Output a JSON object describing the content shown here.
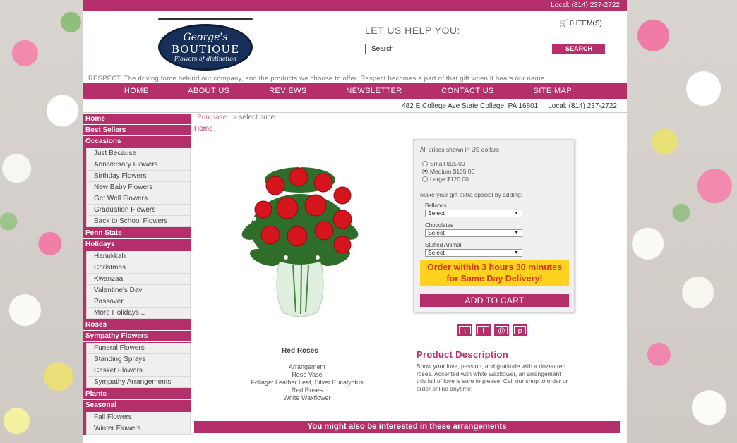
{
  "topbar": {
    "phone": "Local: (814) 237-2722"
  },
  "logo": {
    "line1": "George's",
    "line2": "BOUTIQUE",
    "line3": "Flowers of distinction"
  },
  "header": {
    "help_text": "LET US HELP YOU:",
    "cart_label": "0 ITEM(S)",
    "search_placeholder": "Search",
    "search_button": "SEARCH",
    "tagline": "RESPECT. The driving force behind our company, and the products we choose to offer. Respect becomes a part of that gift when it bears our name."
  },
  "nav": [
    "HOME",
    "ABOUT US",
    "REVIEWS",
    "NEWSLETTER",
    "CONTACT US",
    "SITE MAP"
  ],
  "address_bar": {
    "address": "482 E College Ave State College, PA 16801",
    "phone": "Local: (814) 237-2722"
  },
  "sidebar": [
    {
      "head": "Home",
      "items": []
    },
    {
      "head": "Best Sellers",
      "items": []
    },
    {
      "head": "Occasions",
      "items": [
        "Just Because",
        "Anniversary Flowers",
        "Birthday Flowers",
        "New Baby Flowers",
        "Get Well Flowers",
        "Graduation Flowers",
        "Back to School Flowers"
      ]
    },
    {
      "head": "Penn State",
      "items": []
    },
    {
      "head": "Holidays",
      "items": [
        "Hanukkah",
        "Christmas",
        "Kwanzaa",
        "Valentine's Day",
        "Passover",
        "More Holidays..."
      ]
    },
    {
      "head": "Roses",
      "items": []
    },
    {
      "head": "Sympathy Flowers",
      "items": [
        "Funeral Flowers",
        "Standing Sprays",
        "Casket Flowers",
        "Sympathy Arrangements"
      ]
    },
    {
      "head": "Plants",
      "items": []
    },
    {
      "head": "Seasonal",
      "items": [
        "Fall Flowers",
        "Winter Flowers"
      ]
    }
  ],
  "breadcrumb": {
    "purchase": "Purchase",
    "current": "> select price",
    "home": "Home"
  },
  "product": {
    "name": "Red Roses",
    "details": [
      "Arrangement",
      "Rose Vase",
      "Foliage: Leather Leaf, Silver Eucalyptus",
      "Red Roses",
      "White Waxflower"
    ]
  },
  "pricebox": {
    "note": "All prices shown in US dollars",
    "options": [
      {
        "label": "Small $95.00",
        "selected": false
      },
      {
        "label": "Medium $105.00",
        "selected": true
      },
      {
        "label": "Large $120.00",
        "selected": false
      }
    ],
    "extra_text": "Make your gift extra special by adding:",
    "addons": [
      {
        "label": "Balloons",
        "value": "Select"
      },
      {
        "label": "Chocolates",
        "value": "Select"
      },
      {
        "label": "Stuffed Animal",
        "value": "Select"
      }
    ],
    "delivery_line1": "Order within 3 hours 30 minutes",
    "delivery_line2": "for Same Day Delivery!",
    "add_to_cart": "ADD TO CART"
  },
  "social": [
    "twitter-icon",
    "facebook-icon",
    "email-icon",
    "pinterest-icon"
  ],
  "description": {
    "title": "Product Description",
    "text": "Show your love, passion, and gratitude with a dozen red roses. Accented with white waxflower, an arrangement this full of love is sure to please! Call our shop to order or order online anytime!"
  },
  "also_banner": "You might also be interested in these arrangements",
  "colors": {
    "brand": "#b5306a",
    "delivery_bg": "#ffd21f",
    "delivery_text": "#d2391a"
  }
}
